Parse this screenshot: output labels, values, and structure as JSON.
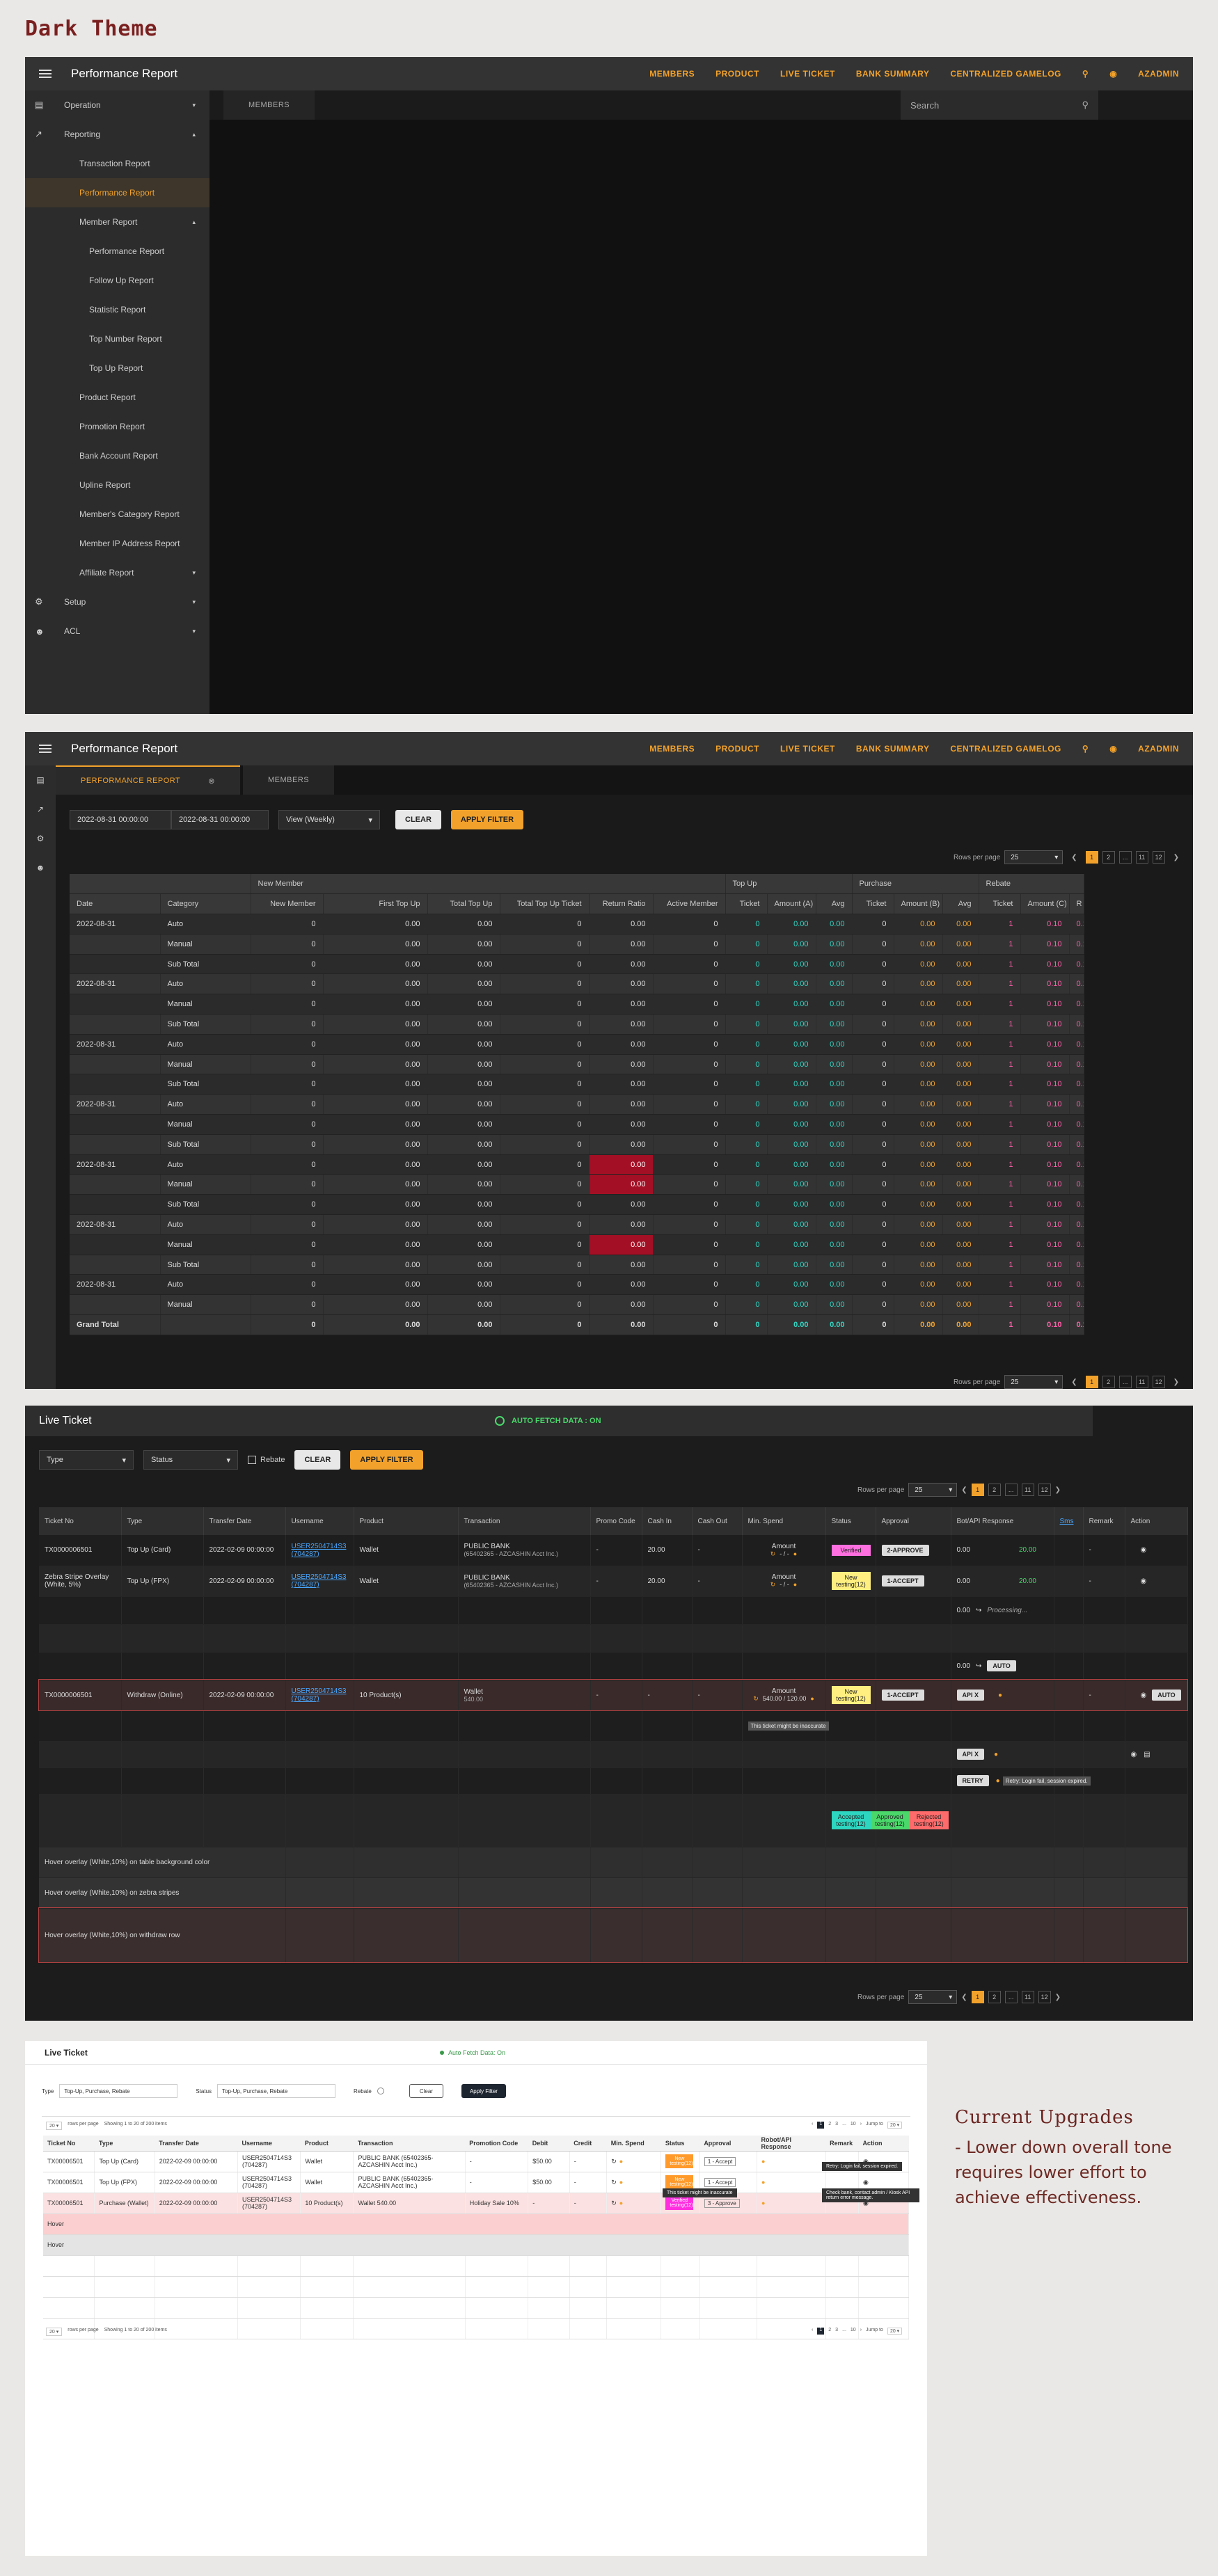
{
  "page_title": "Dark Theme",
  "app": {
    "title": "Performance Report",
    "nav": [
      "MEMBERS",
      "PRODUCT",
      "LIVE TICKET",
      "BANK SUMMARY",
      "CENTRALIZED GAMELOG",
      "AZADMIN"
    ]
  },
  "sidebar": [
    {
      "label": "Operation",
      "icon": "briefcase-icon",
      "level": 1
    },
    {
      "label": "Reporting",
      "icon": "chart-icon",
      "level": 1
    },
    {
      "label": "Transaction Report",
      "level": 2
    },
    {
      "label": "Performance Report",
      "level": 2,
      "active": true
    },
    {
      "label": "Member Report",
      "level": 2
    },
    {
      "label": "Performance Report",
      "level": 3
    },
    {
      "label": "Follow Up Report",
      "level": 3
    },
    {
      "label": "Statistic Report",
      "level": 3
    },
    {
      "label": "Top Number Report",
      "level": 3
    },
    {
      "label": "Top Up Report",
      "level": 3
    },
    {
      "label": "Product Report",
      "level": 2
    },
    {
      "label": "Promotion Report",
      "level": 2
    },
    {
      "label": "Bank Account Report",
      "level": 2
    },
    {
      "label": "Upline Report",
      "level": 2
    },
    {
      "label": "Member's Category Report",
      "level": 2
    },
    {
      "label": "Member IP Address Report",
      "level": 2
    },
    {
      "label": "Affiliate Report",
      "level": 2
    },
    {
      "label": "Setup",
      "icon": "gear-icon",
      "level": 1
    },
    {
      "label": "ACL",
      "icon": "user-gear-icon",
      "level": 1
    }
  ],
  "panel1": {
    "tab": "MEMBERS",
    "search_placeholder": "Search"
  },
  "panel2": {
    "tabs": [
      "PERFORMANCE REPORT",
      "MEMBERS"
    ],
    "date_from": "2022-08-31 00:00:00",
    "date_to": "2022-08-31 00:00:00",
    "view": "View (Weekly)",
    "clear": "CLEAR",
    "apply": "APPLY FILTER",
    "rows_label": "Rows per page",
    "rows_value": "25",
    "pages": [
      "1",
      "2",
      "...",
      "11",
      "12"
    ],
    "group_headers": [
      "New Member",
      "Top Up",
      "Purchase",
      "Rebate"
    ],
    "columns": [
      "Date",
      "Category",
      "New Member",
      "First Top Up",
      "Total Top Up",
      "Total Top Up Ticket",
      "Return Ratio",
      "Active Member",
      "Ticket",
      "Amount (A)",
      "Avg",
      "Ticket",
      "Amount (B)",
      "Avg",
      "Ticket",
      "Amount (C)",
      "R"
    ],
    "rows": [
      {
        "date": "2022-08-31",
        "cat": "Auto"
      },
      {
        "date": "",
        "cat": "Manual"
      },
      {
        "date": "",
        "cat": "Sub Total"
      },
      {
        "date": "2022-08-31",
        "cat": "Auto"
      },
      {
        "date": "",
        "cat": "Manual"
      },
      {
        "date": "",
        "cat": "Sub Total"
      },
      {
        "date": "2022-08-31",
        "cat": "Auto"
      },
      {
        "date": "",
        "cat": "Manual"
      },
      {
        "date": "",
        "cat": "Sub Total"
      },
      {
        "date": "2022-08-31",
        "cat": "Auto"
      },
      {
        "date": "",
        "cat": "Manual"
      },
      {
        "date": "",
        "cat": "Sub Total"
      },
      {
        "date": "2022-08-31",
        "cat": "Auto",
        "red": true
      },
      {
        "date": "",
        "cat": "Manual",
        "red": true
      },
      {
        "date": "",
        "cat": "Sub Total"
      },
      {
        "date": "2022-08-31",
        "cat": "Auto"
      },
      {
        "date": "",
        "cat": "Manual",
        "red": true
      },
      {
        "date": "",
        "cat": "Sub Total"
      },
      {
        "date": "2022-08-31",
        "cat": "Auto"
      },
      {
        "date": "",
        "cat": "Manual"
      }
    ],
    "grand_total": "Grand Total",
    "vals": {
      "zero": "0",
      "money": "0.00",
      "cyan": "0",
      "cyan_money": "0.00",
      "pink_ticket": "1",
      "pink_amount": "0.10"
    }
  },
  "panel3": {
    "title": "Live Ticket",
    "autofetch": "AUTO FETCH DATA : ON",
    "type": "Type",
    "status": "Status",
    "rebate": "Rebate",
    "clear": "CLEAR",
    "apply": "APPLY FILTER",
    "rows_label": "Rows per page",
    "rows_value": "25",
    "pages": [
      "1",
      "2",
      "...",
      "11",
      "12"
    ],
    "columns": [
      "Ticket No",
      "Type",
      "Transfer Date",
      "Username",
      "Product",
      "Transaction",
      "Promo Code",
      "Cash In",
      "Cash Out",
      "Min. Spend",
      "Status",
      "Approval",
      "Bot/API Response",
      "Sms",
      "Remark",
      "Action"
    ],
    "rows": [
      {
        "no": "TX0000006501",
        "type": "Top Up (Card)",
        "date": "2022-02-09 00:00:00",
        "user": "USER2504714S3 (704287)",
        "product": "Wallet",
        "trans": "PUBLIC BANK",
        "trans2": "(65402365 - AZCASHIN Acct Inc.)",
        "promo": "-",
        "cin": "20.00",
        "cout": "-",
        "min": "Amount",
        "min2": "- / -",
        "status": "Verified",
        "approval": "2-APPROVE",
        "bot": "0.00",
        "bot2": "20.00",
        "remark": "-"
      },
      {
        "no": "Zebra Stripe Overlay (White, 5%)",
        "type": "Top Up (FPX)",
        "date": "2022-02-09 00:00:00",
        "user": "USER2504714S3 (704287)",
        "product": "Wallet",
        "trans": "PUBLIC BANK",
        "trans2": "(65402365 - AZCASHIN Acct Inc.)",
        "promo": "-",
        "cin": "20.00",
        "cout": "-",
        "min": "Amount",
        "min2": "- / -",
        "status": "New testing(12)",
        "approval": "1-ACCEPT",
        "bot": "0.00",
        "bot2": "20.00",
        "remark": "-"
      },
      {
        "no": "TX0000006501",
        "type": "Withdraw (Online)",
        "date": "2022-02-09 00:00:00",
        "user": "USER2504714S3 (704287)",
        "product": "10 Product(s)",
        "trans": "Wallet",
        "trans2": "540.00",
        "promo": "-",
        "cin": "-",
        "cout": "-",
        "min": "Amount",
        "min2": "540.00 / 120.00",
        "status": "New testing(12)",
        "approval": "1-ACCEPT",
        "bot": "API X",
        "remark": "-"
      }
    ],
    "processing": "Processing...",
    "bot_amount": "0.00",
    "auto": "AUTO",
    "tooltip_inaccurate": "This ticket might be inaccurate",
    "retry": "RETRY",
    "retry_tip": "Retry: Login fail, session expired.",
    "api_x": "API X",
    "chips": [
      "Accepted testing(12)",
      "Approved testing(12)",
      "Rejected testing(12)"
    ],
    "hover_rows": [
      "Hover overlay (White,10%) on table background color",
      "Hover overlay (White,10%) on zebra stripes",
      "Hover overlay (White,10%) on withdraw row"
    ]
  },
  "light": {
    "title": "Live Ticket",
    "autofetch": "Auto Fetch Data: On",
    "type_label": "Type",
    "type_value": "Top-Up, Purchase, Rebate",
    "status_label": "Status",
    "status_value": "Top-Up, Purchase, Rebate",
    "rebate": "Rebate",
    "clear": "Clear",
    "apply": "Apply Filter",
    "rows_info": "rows per page",
    "showing": "Showing 1 to 20 of 200 items",
    "jump": "Jump to",
    "columns": [
      "Ticket No",
      "Type",
      "Transfer Date",
      "Username",
      "Product",
      "Transaction",
      "Promotion Code",
      "Debit",
      "Credit",
      "Min. Spend",
      "Status",
      "Approval",
      "Robot/API Response",
      "Remark",
      "Action"
    ],
    "rows": [
      {
        "no": "TX00006501",
        "type": "Top Up (Card)",
        "date": "2022-02-09 00:00:00",
        "user": "USER2504714S3 (704287)",
        "product": "Wallet",
        "trans": "PUBLIC BANK (65402365-AZCASHIN Acct Inc.)",
        "promo": "-",
        "debit": "$50.00",
        "credit": "-",
        "status": "New testing(12)",
        "approval": "1 - Accept"
      },
      {
        "no": "TX00006501",
        "type": "Top Up (FPX)",
        "date": "2022-02-09 00:00:00",
        "user": "USER2504714S3 (704287)",
        "product": "Wallet",
        "trans": "PUBLIC BANK (65402365-AZCASHIN Acct Inc.)",
        "promo": "-",
        "debit": "$50.00",
        "credit": "-",
        "status": "New testing(12)",
        "approval": "1 - Accept"
      },
      {
        "no": "TX00006501",
        "type": "Purchase (Wallet)",
        "date": "2022-02-09 00:00:00",
        "user": "USER2504714S3 (704287)",
        "product": "10 Product(s)",
        "trans": "Wallet 540.00",
        "promo": "Holiday Sale 10%",
        "debit": "-",
        "credit": "-",
        "status": "Verified testing(12)",
        "approval": "3 - Approve"
      }
    ],
    "hover": [
      "Hover",
      "Hover"
    ],
    "tip1": "Retry: Login fail, session expired.",
    "tip2": "Check bank, contact admin / Kiosk API return error message.",
    "tip3": "This ticket might be inaccurate",
    "pages": [
      "1",
      "2",
      "3",
      "...",
      "10"
    ]
  },
  "upgrades": {
    "title": "Current Upgrades",
    "text": "- Lower down overall tone requires lower effort to achieve effectiveness."
  }
}
